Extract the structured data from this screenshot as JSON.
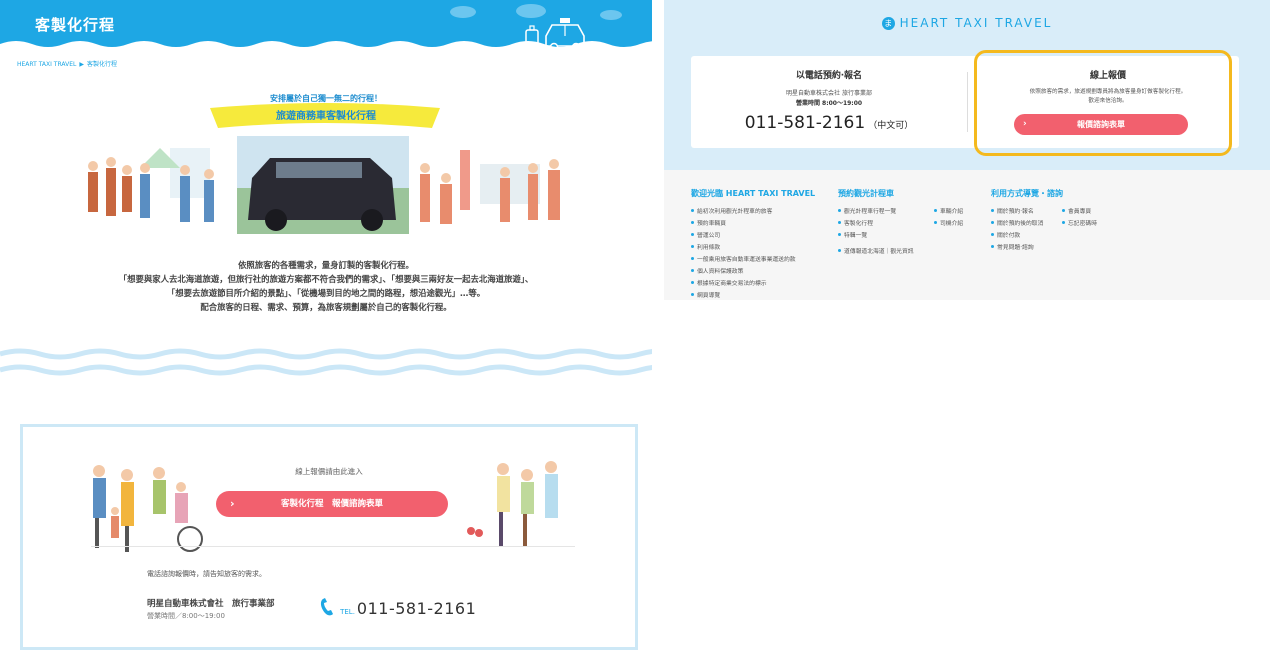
{
  "left": {
    "header": {
      "title": "客製化行程"
    },
    "breadcrumb": {
      "home": "HEART TAXI TRAVEL",
      "sep": "▶",
      "current": "客製化行程"
    },
    "banner": {
      "subtitle": "安排屬於自己獨一無二的行程！",
      "title": "旅遊商務車客製化行程"
    },
    "description": [
      "依照旅客的各種需求，量身訂製的客製化行程。",
      "「想要與家人去北海道旅遊，但旅行社的旅遊方案都不符合我們的需求」、「想要與三兩好友一起去北海道旅遊」、",
      "「想要去旅遊節目所介紹的景點」、「從機場到目的地之間的路程，想沿途觀光」…等。",
      "配合旅客的日程、需求、預算，為旅客規劃屬於自己的客製化行程。"
    ],
    "cta": {
      "note": "線上報價請由此進入",
      "button_label": "客製化行程　報價諮詢表單",
      "tel_note": "電話諮詢報價時，請告知旅客的需求。",
      "company": "明星自動車株式會社　旅行事業部",
      "hours": "營業時間／8:00〜19:00",
      "tel_label": "TEL.",
      "tel_number": "011-581-2161"
    }
  },
  "right": {
    "logo_mark": "ま",
    "logo_text": "HEART TAXI TRAVEL",
    "phone": {
      "heading": "以電話預約‧報名",
      "company": "明星自動車株式会社 旅行事業部",
      "hours": "營業時間 8:00～19:00",
      "number": "011-581-2161",
      "lang_note": "（中文可）"
    },
    "online": {
      "heading": "線上報價",
      "desc_line1": "依照旅客的需求，旅遊規劃專員將為旅客量身訂做客製化行程。",
      "desc_line2": "歡迎來信洽詢。",
      "button_label": "報價諮詢表單"
    },
    "footer": {
      "col1": {
        "heading": "歡迎光臨 HEART TAXI TRAVEL",
        "links": [
          "給初次利用觀光計程車的旅客",
          "預約車輛頁",
          "營運公司",
          "利用條款",
          "一般乘用旅客自動車運送事業運送約款",
          "個人資料保護政策",
          "根據特定商業交易法的標示",
          "網頁導覽"
        ]
      },
      "col2": {
        "heading": "預約觀光計程車",
        "links_a": [
          "觀光計程車行程一覽",
          "客製化行程",
          "特輯一覽",
          "道傳報道北海道｜觀光資訊"
        ],
        "links_b": [
          "車輛介紹",
          "司機介紹"
        ]
      },
      "col3": {
        "heading": "利用方式導覽・諮詢",
        "links_a": [
          "關於預約‧報名",
          "關於預約後的取消",
          "關於付款",
          "常見問題‧諮詢"
        ],
        "links_b": [
          "會員專頁",
          "忘記密碼時"
        ]
      }
    }
  }
}
